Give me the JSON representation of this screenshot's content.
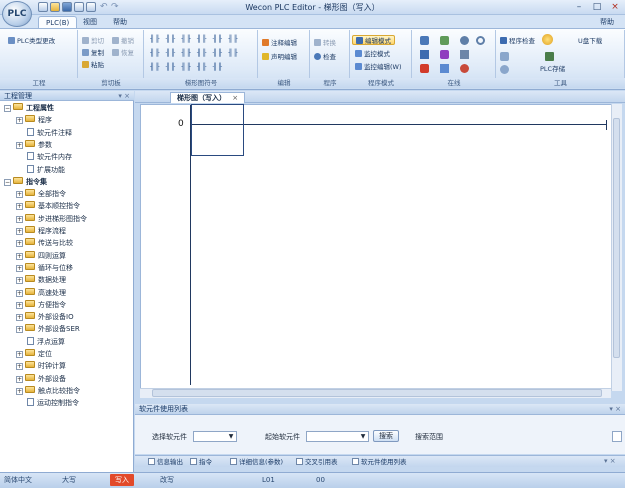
{
  "title_bar": {
    "title": "Wecon PLC Editor - 梯形图（写入）"
  },
  "app_button": {
    "label": "PLC"
  },
  "ribbon_tabs": [
    "PLC(B)",
    "视图",
    "帮助"
  ],
  "help_right": "帮助",
  "ribbon": {
    "project": {
      "btn": "PLC类型更改",
      "label": "工程"
    },
    "clipboard": {
      "items": [
        "剪切",
        "撤销",
        "复制",
        "恢复",
        "粘贴"
      ],
      "label": "剪切板"
    },
    "ladder_symbols": {
      "rows": [
        "╢╟ ╢╟ ╢╟ ╢╟ ╢╟ ╢╟",
        "╢╟ ╢╟ ╢╟ ╢╟ ╢╟ ╢╟",
        "╢╟ ╢╟ ╢╟ ╢╟ ╢╟"
      ],
      "label": "梯形图符号"
    },
    "comment": {
      "items": [
        "注释编辑",
        "声明编辑"
      ],
      "label": "编辑"
    },
    "program": {
      "items": [
        "转换",
        "检查"
      ],
      "label": "程序"
    },
    "mode": {
      "items": [
        "编辑模式",
        "监控模式",
        "监控编辑(W)"
      ],
      "label": "程序模式"
    },
    "online": {
      "label": "在线"
    },
    "tools": {
      "items": [
        "程序检查",
        "PLC存储",
        "U盘下载"
      ],
      "label": "工具"
    }
  },
  "left_panel": {
    "title": "工程管理",
    "tree": [
      {
        "label": "工程属性",
        "level": 0,
        "type": "folder",
        "bold": true,
        "exp": "−"
      },
      {
        "label": "程序",
        "level": 1,
        "type": "folder",
        "exp": "+"
      },
      {
        "label": "软元件注释",
        "level": 1,
        "type": "doc"
      },
      {
        "label": "参数",
        "level": 1,
        "type": "folder",
        "exp": "+"
      },
      {
        "label": "软元件内存",
        "level": 1,
        "type": "doc"
      },
      {
        "label": "扩展功能",
        "level": 1,
        "type": "doc"
      },
      {
        "label": "指令集",
        "level": 0,
        "type": "folder",
        "bold": true,
        "exp": "−"
      },
      {
        "label": "全部指令",
        "level": 1,
        "type": "folder",
        "exp": "+"
      },
      {
        "label": "基本顺控指令",
        "level": 1,
        "type": "folder",
        "exp": "+"
      },
      {
        "label": "步进梯形图指令",
        "level": 1,
        "type": "folder",
        "exp": "+"
      },
      {
        "label": "程序流程",
        "level": 1,
        "type": "folder",
        "exp": "+"
      },
      {
        "label": "传送与比较",
        "level": 1,
        "type": "folder",
        "exp": "+"
      },
      {
        "label": "四则运算",
        "level": 1,
        "type": "folder",
        "exp": "+"
      },
      {
        "label": "循环与位移",
        "level": 1,
        "type": "folder",
        "exp": "+"
      },
      {
        "label": "数据处理",
        "level": 1,
        "type": "folder",
        "exp": "+"
      },
      {
        "label": "高速处理",
        "level": 1,
        "type": "folder",
        "exp": "+"
      },
      {
        "label": "方便指令",
        "level": 1,
        "type": "folder",
        "exp": "+"
      },
      {
        "label": "外部设备IO",
        "level": 1,
        "type": "folder",
        "exp": "+"
      },
      {
        "label": "外部设备SER",
        "level": 1,
        "type": "folder",
        "exp": "+"
      },
      {
        "label": "浮点运算",
        "level": 1,
        "type": "doc"
      },
      {
        "label": "定位",
        "level": 1,
        "type": "folder",
        "exp": "+"
      },
      {
        "label": "时钟计算",
        "level": 1,
        "type": "folder",
        "exp": "+"
      },
      {
        "label": "外部设备",
        "level": 1,
        "type": "folder",
        "exp": "+"
      },
      {
        "label": "触点比较指令",
        "level": 1,
        "type": "folder",
        "exp": "+"
      },
      {
        "label": "运动控制指令",
        "level": 1,
        "type": "doc"
      }
    ]
  },
  "doc_tab": {
    "label": "梯形图（写入）",
    "close": "×"
  },
  "editor": {
    "step_number": "0"
  },
  "usage_panel": {
    "title": "软元件使用列表",
    "select_label": "选择软元件",
    "start_label": "起始软元件",
    "search_button": "搜索",
    "range_label": "搜索范围"
  },
  "bottom_tabs": [
    "信息输出",
    "指令",
    "详细信息(参数)",
    "交叉引用表",
    "软元件使用列表"
  ],
  "status_bar": {
    "lang": "简体中文",
    "size": "大写",
    "mode": "写入",
    "state": "改写",
    "pos": "L01",
    "col": "00"
  }
}
